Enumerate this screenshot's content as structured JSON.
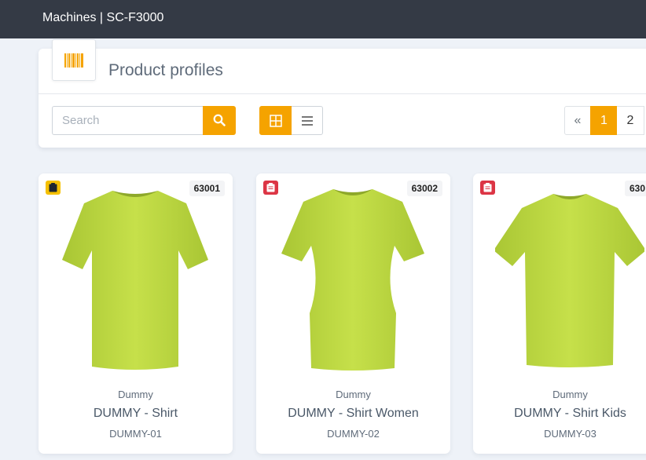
{
  "header": {
    "breadcrumb": "Machines | SC-F3000"
  },
  "panel": {
    "title": "Product profiles",
    "logo_icon": "barcode-icon",
    "search": {
      "placeholder": "Search",
      "value": ""
    },
    "view_mode": {
      "active": "grid",
      "options": [
        "grid",
        "list"
      ]
    },
    "pagination": {
      "prev_label": "«",
      "pages": [
        "1",
        "2"
      ],
      "current": "1"
    }
  },
  "colors": {
    "accent": "#f5a300",
    "topbar": "#343a45",
    "badge_yellow": "#f5c000",
    "badge_red": "#dc3545",
    "shirt": "#bcd742"
  },
  "products": [
    {
      "code": "63001",
      "brand": "Dummy",
      "name": "DUMMY - Shirt",
      "sku": "DUMMY-01",
      "status_icon": "clipboard-icon",
      "status_color": "#f5c000"
    },
    {
      "code": "63002",
      "brand": "Dummy",
      "name": "DUMMY - Shirt Women",
      "sku": "DUMMY-02",
      "status_icon": "clipboard-icon",
      "status_color": "#dc3545"
    },
    {
      "code": "630",
      "brand": "Dummy",
      "name": "DUMMY - Shirt Kids",
      "sku": "DUMMY-03",
      "status_icon": "clipboard-icon",
      "status_color": "#dc3545"
    }
  ]
}
